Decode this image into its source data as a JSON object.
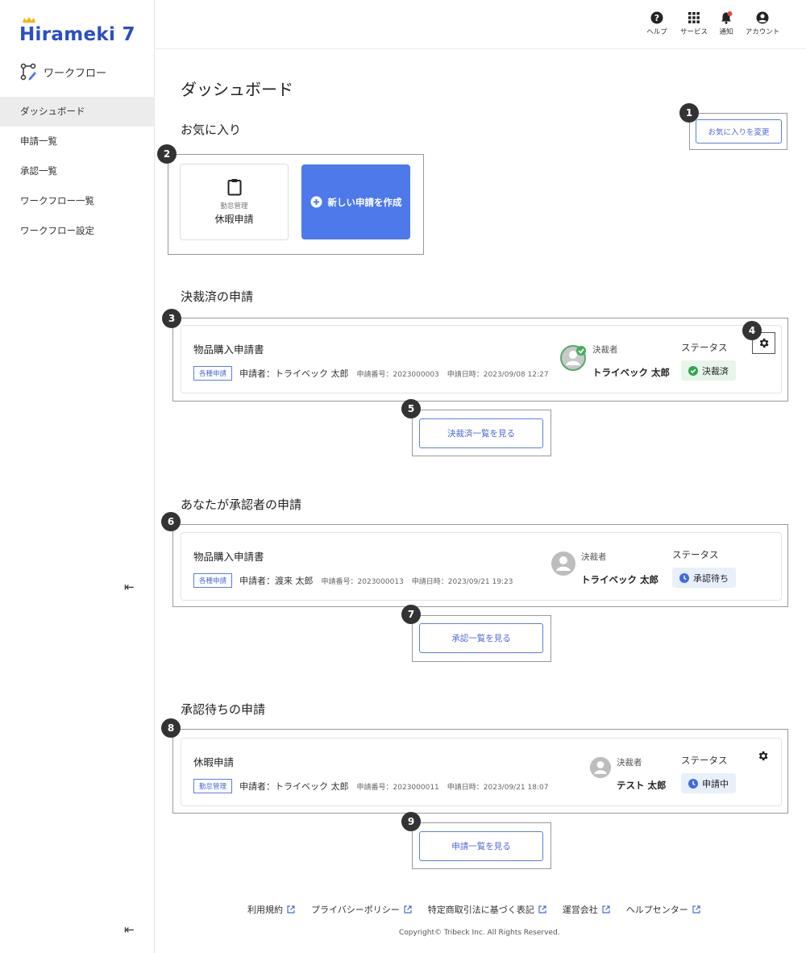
{
  "brand": {
    "logo_text": "Hirameki 7",
    "app_name": "ワークフロー",
    "accent": "#4d79eb"
  },
  "sidebar": {
    "items": [
      {
        "label": "ダッシュボード",
        "active": true
      },
      {
        "label": "申請一覧"
      },
      {
        "label": "承認一覧"
      },
      {
        "label": "ワークフロー一覧"
      },
      {
        "label": "ワークフロー設定"
      }
    ],
    "collapse_glyph": "⇤"
  },
  "header": {
    "tools": [
      {
        "label": "ヘルプ",
        "icon": "help-icon"
      },
      {
        "label": "サービス",
        "icon": "grid-icon"
      },
      {
        "label": "通知",
        "icon": "bell-icon"
      },
      {
        "label": "アカウント",
        "icon": "account-icon"
      }
    ]
  },
  "main": {
    "title": "ダッシュボード",
    "favorites": {
      "title": "お気に入り",
      "change_button": "お気に入りを変更",
      "card": {
        "category": "勤怠管理",
        "name": "休暇申請"
      },
      "new_button": "新しい申請を作成"
    },
    "completed": {
      "title": "決裁済の申請",
      "item": {
        "title": "物品購入申請書",
        "tag": "各種申請",
        "applicant": "申請者：トライベック 太郎",
        "number": "申請番号：2023000003",
        "date": "申請日時：2023/09/08 12:27",
        "approver_label": "決裁者",
        "approver": "トライベック 太郎",
        "status_label": "ステータス",
        "status": "決裁済"
      },
      "view_button": "決裁済一覧を見る"
    },
    "as_approver": {
      "title": "あなたが承認者の申請",
      "item": {
        "title": "物品購入申請書",
        "tag": "各種申請",
        "applicant": "申請者：渡来 太郎",
        "number": "申請番号：2023000013",
        "date": "申請日時：2023/09/21 19:23",
        "approver_label": "決裁者",
        "approver": "トライベック 太郎",
        "status_label": "ステータス",
        "status": "承認待ち"
      },
      "view_button": "承認一覧を見る"
    },
    "pending": {
      "title": "承認待ちの申請",
      "item": {
        "title": "休暇申請",
        "tag": "勤怠管理",
        "applicant": "申請者：トライベック 太郎",
        "number": "申請番号：2023000011",
        "date": "申請日時：2023/09/21 18:07",
        "approver_label": "決裁者",
        "approver": "テスト 太郎",
        "status_label": "ステータス",
        "status": "申請中"
      },
      "view_button": "申請一覧を見る"
    },
    "markers": [
      "1",
      "2",
      "3",
      "4",
      "5",
      "6",
      "7",
      "8",
      "9"
    ]
  },
  "footer": {
    "links": [
      "利用規約",
      "プライバシーポリシー",
      "特定商取引法に基づく表記",
      "運営会社",
      "ヘルプセンター"
    ],
    "copyright": "Copyright© Tribeck Inc. All Rights Reserved."
  }
}
